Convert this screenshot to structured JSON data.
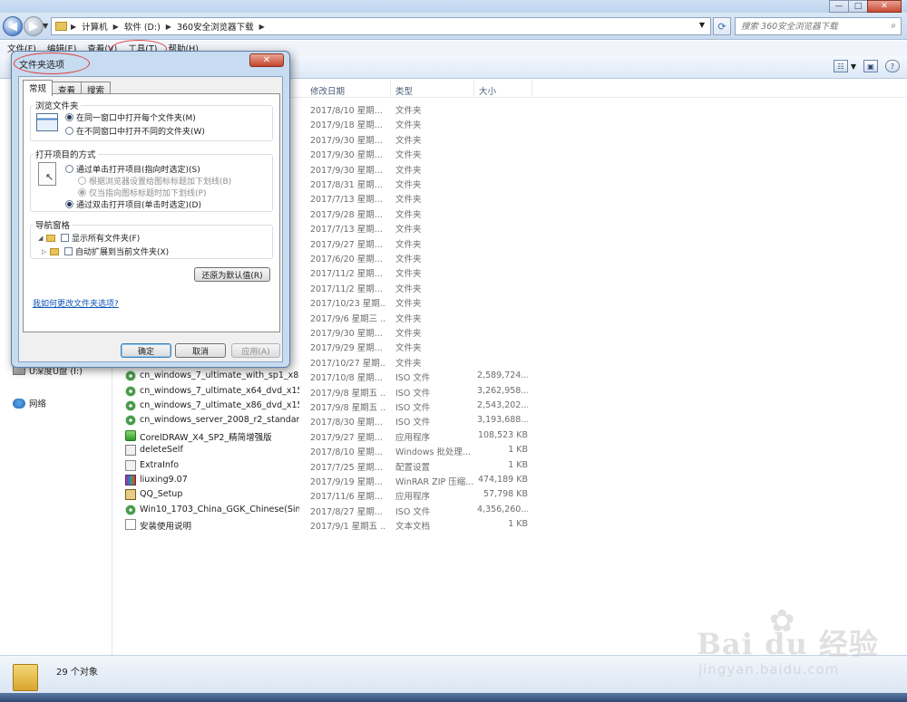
{
  "window": {
    "minimize": "—",
    "maximize": "□",
    "close": "✕"
  },
  "nav": {
    "breadcrumbs": [
      "计算机",
      "软件 (D:)",
      "360安全浏览器下载"
    ],
    "search_placeholder": "搜索 360安全浏览器下载"
  },
  "menu": [
    "文件(F)",
    "编辑(E)",
    "查看(V)",
    "工具(T)",
    "帮助(H)"
  ],
  "columns": {
    "date": "修改日期",
    "type": "类型",
    "size": "大小"
  },
  "sidebar": {
    "drive_label": "U深度U盘 (I:)",
    "network_label": "网络"
  },
  "files": [
    {
      "name": "",
      "date": "2017/8/10 星期...",
      "type": "文件夹",
      "size": "",
      "icon": "folder"
    },
    {
      "name": "",
      "date": "2017/9/18 星期...",
      "type": "文件夹",
      "size": "",
      "icon": "folder"
    },
    {
      "name": "",
      "date": "2017/9/30 星期...",
      "type": "文件夹",
      "size": "",
      "icon": "folder"
    },
    {
      "name": "",
      "date": "2017/9/30 星期...",
      "type": "文件夹",
      "size": "",
      "icon": "folder"
    },
    {
      "name": "",
      "date": "2017/9/30 星期...",
      "type": "文件夹",
      "size": "",
      "icon": "folder"
    },
    {
      "name": "",
      "date": "2017/8/31 星期...",
      "type": "文件夹",
      "size": "",
      "icon": "folder"
    },
    {
      "name": "",
      "date": "2017/7/13 星期...",
      "type": "文件夹",
      "size": "",
      "icon": "folder"
    },
    {
      "name": "",
      "date": "2017/9/28 星期...",
      "type": "文件夹",
      "size": "",
      "icon": "folder"
    },
    {
      "name": "",
      "date": "2017/7/13 星期...",
      "type": "文件夹",
      "size": "",
      "icon": "folder"
    },
    {
      "name": "",
      "date": "2017/9/27 星期...",
      "type": "文件夹",
      "size": "",
      "icon": "folder"
    },
    {
      "name": "",
      "date": "2017/6/20 星期...",
      "type": "文件夹",
      "size": "",
      "icon": "folder"
    },
    {
      "name": "",
      "date": "2017/11/2 星期...",
      "type": "文件夹",
      "size": "",
      "icon": "folder"
    },
    {
      "name": "",
      "date": "2017/11/2 星期...",
      "type": "文件夹",
      "size": "",
      "icon": "folder"
    },
    {
      "name": "",
      "date": "2017/10/23 星期...",
      "type": "文件夹",
      "size": "",
      "icon": "folder"
    },
    {
      "name": "",
      "date": "2017/9/6 星期三 ...",
      "type": "文件夹",
      "size": "",
      "icon": "folder"
    },
    {
      "name": "",
      "date": "2017/9/30 星期...",
      "type": "文件夹",
      "size": "",
      "icon": "folder"
    },
    {
      "name": "",
      "date": "2017/9/29 星期...",
      "type": "文件夹",
      "size": "",
      "icon": "folder"
    },
    {
      "name": "",
      "date": "2017/10/27 星期...",
      "type": "文件夹",
      "size": "",
      "icon": "folder"
    },
    {
      "name": "cn_windows_7_ultimate_with_sp1_x86_...",
      "date": "2017/10/8 星期...",
      "type": "ISO 文件",
      "size": "2,589,724...",
      "icon": "iso"
    },
    {
      "name": "cn_windows_7_ultimate_x64_dvd_x15-...",
      "date": "2017/9/8 星期五 ...",
      "type": "ISO 文件",
      "size": "3,262,958...",
      "icon": "iso"
    },
    {
      "name": "cn_windows_7_ultimate_x86_dvd_x15-...",
      "date": "2017/9/8 星期五 ...",
      "type": "ISO 文件",
      "size": "2,543,202...",
      "icon": "iso"
    },
    {
      "name": "cn_windows_server_2008_r2_standard...",
      "date": "2017/8/30 星期...",
      "type": "ISO 文件",
      "size": "3,193,688...",
      "icon": "iso"
    },
    {
      "name": "CorelDRAW_X4_SP2_精简增强版",
      "date": "2017/9/27 星期...",
      "type": "应用程序",
      "size": "108,523 KB",
      "icon": "exe"
    },
    {
      "name": "deleteSelf",
      "date": "2017/8/10 星期...",
      "type": "Windows 批处理...",
      "size": "1 KB",
      "icon": "bat"
    },
    {
      "name": "ExtraInfo",
      "date": "2017/7/25 星期...",
      "type": "配置设置",
      "size": "1 KB",
      "icon": "ini"
    },
    {
      "name": "liuxing9.07",
      "date": "2017/9/19 星期...",
      "type": "WinRAR ZIP 压缩...",
      "size": "474,189 KB",
      "icon": "rar"
    },
    {
      "name": "QQ_Setup",
      "date": "2017/11/6 星期...",
      "type": "应用程序",
      "size": "57,798 KB",
      "icon": "qq"
    },
    {
      "name": "Win10_1703_China_GGK_Chinese(Sim...",
      "date": "2017/8/27 星期...",
      "type": "ISO 文件",
      "size": "4,356,260...",
      "icon": "iso"
    },
    {
      "name": "安装使用说明",
      "date": "2017/9/1 星期五 ...",
      "type": "文本文档",
      "size": "1 KB",
      "icon": "txt"
    }
  ],
  "status": {
    "count": "29 个对象"
  },
  "watermark": {
    "line1": "Bai du 经验",
    "line2": "jingyan.baidu.com"
  },
  "dialog": {
    "title": "文件夹选项",
    "close": "✕",
    "tabs": [
      "常规",
      "查看",
      "搜索"
    ],
    "browse": {
      "label": "浏览文件夹",
      "opt1": "在同一窗口中打开每个文件夹(M)",
      "opt2": "在不同窗口中打开不同的文件夹(W)"
    },
    "click": {
      "label": "打开项目的方式",
      "opt1": "通过单击打开项目(指向时选定)(S)",
      "sub1": "根据浏览器设置给图标标题加下划线(B)",
      "sub2": "仅当指向图标标题时加下划线(P)",
      "opt2": "通过双击打开项目(单击时选定)(D)"
    },
    "navpane": {
      "label": "导航窗格",
      "opt1": "显示所有文件夹(F)",
      "opt2": "自动扩展到当前文件夹(X)"
    },
    "restore": "还原为默认值(R)",
    "help": "我如何更改文件夹选项?",
    "ok": "确定",
    "cancel": "取消",
    "apply": "应用(A)"
  }
}
